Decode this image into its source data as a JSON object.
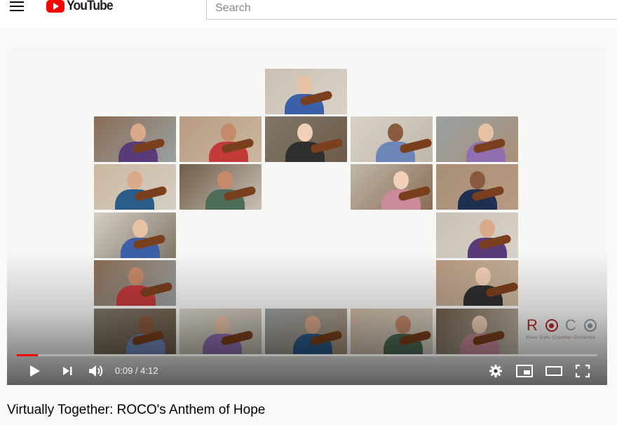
{
  "masthead": {
    "logo_text": "YouTube",
    "search_placeholder": "Search"
  },
  "video": {
    "title": "Virtually Together: ROCO's Anthem of Hope",
    "current_time": "0:09",
    "duration": "4:12",
    "progress_fraction": 0.036,
    "brand_color": "#ff0000"
  },
  "overlay_logo": {
    "letters": [
      "R",
      "C"
    ],
    "subtitle": "River Oaks Chamber Orchestra"
  },
  "icons": {
    "menu": "hamburger-icon",
    "play": "play-icon",
    "next": "next-icon",
    "volume": "volume-icon",
    "settings": "gear-icon",
    "miniplayer": "miniplayer-icon",
    "theater": "theater-mode-icon",
    "fullscreen": "fullscreen-icon"
  }
}
